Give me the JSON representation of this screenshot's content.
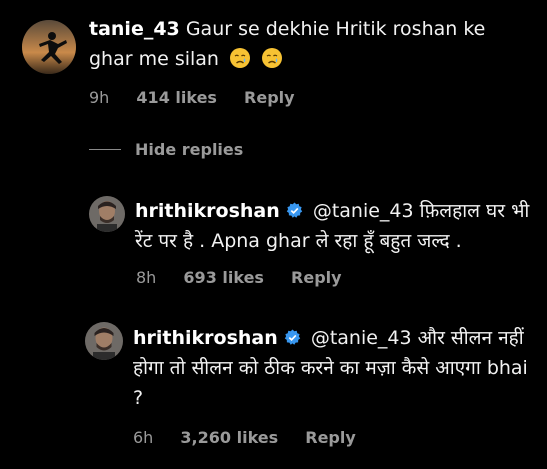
{
  "comments": [
    {
      "username": "tanie_43",
      "text": "Gaur se dekhie Hritik roshan ke ghar me silan",
      "time": "9h",
      "likes": "414 likes",
      "reply_label": "Reply",
      "emoji_icon": "crying-face-icon"
    }
  ],
  "hide_replies_label": "Hide replies",
  "replies": [
    {
      "username": "hrithikroshan",
      "verified_icon": "verified-badge-icon",
      "text": "@tanie_43 फ़िलहाल घर भी रेंट पर है . Apna ghar ले रहा हूँ बहुत जल्द .",
      "time": "8h",
      "likes": "693 likes",
      "reply_label": "Reply"
    },
    {
      "username": "hrithikroshan",
      "verified_icon": "verified-badge-icon",
      "text": "@tanie_43 और सीलन नहीं होगा तो सीलन को ठीक करने का मज़ा कैसे आएगा bhai ?",
      "time": "6h",
      "likes": "3,260 likes",
      "reply_label": "Reply"
    }
  ],
  "colors": {
    "background": "#000000",
    "text": "#f2f2f2",
    "secondary": "#9a9a9a",
    "verified": "#3897f0"
  }
}
